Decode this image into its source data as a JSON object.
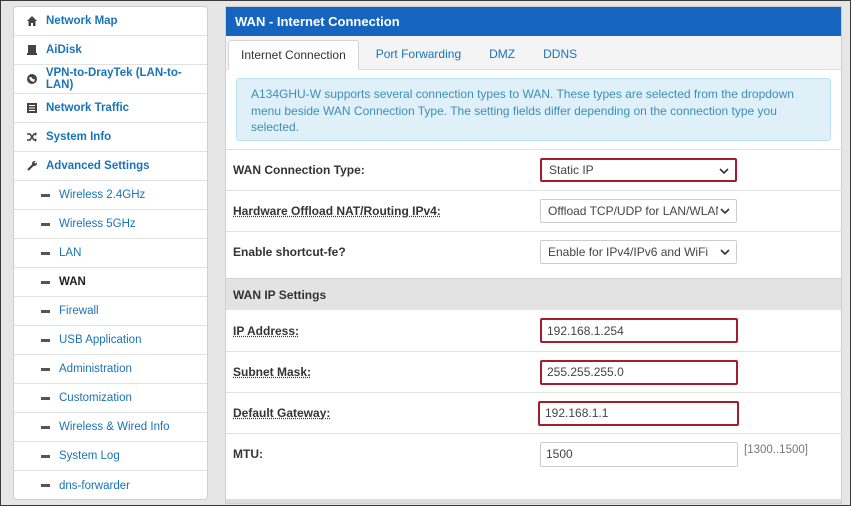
{
  "sidebar": {
    "top_items": [
      {
        "label": "Network Map",
        "icon": "home-icon"
      },
      {
        "label": "AiDisk",
        "icon": "disk-icon"
      },
      {
        "label": "VPN-to-DrayTek (LAN-to-LAN)",
        "icon": "globe-icon"
      },
      {
        "label": "Network Traffic",
        "icon": "list-icon"
      },
      {
        "label": "System Info",
        "icon": "shuffle-icon"
      },
      {
        "label": "Advanced Settings",
        "icon": "wrench-icon"
      }
    ],
    "sub_items": [
      {
        "label": "Wireless 2.4GHz"
      },
      {
        "label": "Wireless 5GHz"
      },
      {
        "label": "LAN"
      },
      {
        "label": "WAN",
        "active": true
      },
      {
        "label": "Firewall"
      },
      {
        "label": "USB Application"
      },
      {
        "label": "Administration"
      },
      {
        "label": "Customization"
      },
      {
        "label": "Wireless & Wired Info"
      },
      {
        "label": "System Log"
      },
      {
        "label": "dns-forwarder"
      }
    ]
  },
  "main": {
    "title": "WAN - Internet Connection",
    "tabs": [
      "Internet Connection",
      "Port Forwarding",
      "DMZ",
      "DDNS"
    ],
    "info_text": "A134GHU-W supports several connection types to WAN. These types are selected from the dropdown menu beside WAN Connection Type. The setting fields differ depending on the connection type you selected.",
    "fields": {
      "wan_type": {
        "label": "WAN Connection Type:",
        "value": "Static IP"
      },
      "hw_offload": {
        "label": "Hardware Offload NAT/Routing IPv4:",
        "value": "Offload TCP/UDP for LAN/WLAN"
      },
      "shortcut": {
        "label": "Enable shortcut-fe?",
        "value": "Enable for IPv4/IPv6 and WiFi"
      }
    },
    "section_title": "WAN IP Settings",
    "ip": {
      "ip_address": {
        "label": "IP Address:",
        "value": "192.168.1.254"
      },
      "subnet": {
        "label": "Subnet Mask:",
        "value": "255.255.255.0"
      },
      "gateway": {
        "label": "Default Gateway:",
        "value": "192.168.1.1"
      },
      "mtu": {
        "label": "MTU:",
        "value": "1500",
        "hint": "[1300..1500]"
      }
    }
  },
  "colors": {
    "header": "#1565c0",
    "link": "#1a73b8",
    "highlight": "#a51d2d",
    "info_bg": "#dff0f8"
  }
}
